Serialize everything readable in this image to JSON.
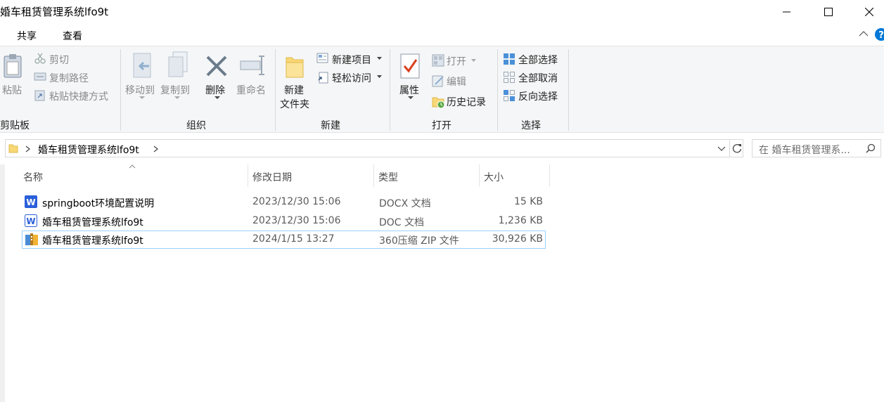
{
  "window": {
    "title": "婚车租赁管理系统lfo9t"
  },
  "tabs": [
    {
      "label": "共享"
    },
    {
      "label": "查看"
    }
  ],
  "ribbon": {
    "clipboard": {
      "paste_label": "粘贴",
      "cut_label": "剪切",
      "copy_path_label": "复制路径",
      "paste_shortcut_label": "粘贴快捷方式",
      "group_label": "剪贴板"
    },
    "organize": {
      "move_to_label": "移动到",
      "copy_to_label": "复制到",
      "delete_label": "删除",
      "rename_label": "重命名",
      "group_label": "组织"
    },
    "new": {
      "new_folder_label_1": "新建",
      "new_folder_label_2": "文件夹",
      "new_item_label": "新建项目",
      "easy_access_label": "轻松访问",
      "group_label": "新建"
    },
    "open": {
      "properties_label": "属性",
      "open_label": "打开",
      "edit_label": "编辑",
      "history_label": "历史记录",
      "group_label": "打开"
    },
    "select": {
      "select_all_label": "全部选择",
      "select_none_label": "全部取消",
      "invert_label": "反向选择",
      "group_label": "选择"
    }
  },
  "address": {
    "path": "婚车租赁管理系统lfo9t",
    "search_placeholder": "在 婚车租赁管理系..."
  },
  "columns": {
    "name": "名称",
    "modified": "修改日期",
    "type": "类型",
    "size": "大小"
  },
  "files": [
    {
      "name": "springboot环境配置说明",
      "modified": "2023/12/30 15:06",
      "type": "DOCX 文档",
      "size": "15 KB",
      "icon": "word-docx-icon"
    },
    {
      "name": "婚车租赁管理系统lfo9t",
      "modified": "2023/12/30 15:06",
      "type": "DOC 文档",
      "size": "1,236 KB",
      "icon": "word-doc-icon"
    },
    {
      "name": "婚车租赁管理系统lfo9t",
      "modified": "2024/1/15 13:27",
      "type": "360压缩 ZIP 文件",
      "size": "30,926 KB",
      "icon": "zip-archive-icon"
    }
  ],
  "colors": {
    "accent": "#0078d7",
    "selection_border": "#99d1ff",
    "ribbon_bg": "#f5f6f7"
  }
}
